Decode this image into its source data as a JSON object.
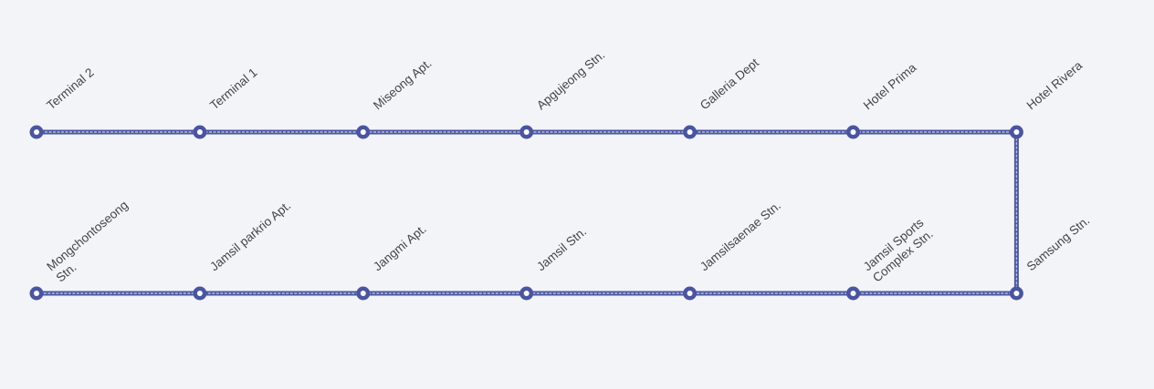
{
  "route": {
    "line_color": "#4a55a2",
    "line_inner_color": "#b7bde0",
    "marker_fill": "#ffffff",
    "rows": [
      {
        "stops": [
          {
            "lines": [
              "Terminal 2"
            ]
          },
          {
            "lines": [
              "Terminal 1"
            ]
          },
          {
            "lines": [
              "Miseong Apt."
            ]
          },
          {
            "lines": [
              "Apgujeong Stn."
            ]
          },
          {
            "lines": [
              "Galleria Dept"
            ]
          },
          {
            "lines": [
              "Hotel Prima"
            ]
          },
          {
            "lines": [
              "Hotel Rivera"
            ]
          }
        ]
      },
      {
        "stops": [
          {
            "lines": [
              "Mongchontoseong",
              "Stn."
            ]
          },
          {
            "lines": [
              "Jamsil parkrio Apt."
            ]
          },
          {
            "lines": [
              "Jangmi Apt."
            ]
          },
          {
            "lines": [
              "Jamsil Stn."
            ]
          },
          {
            "lines": [
              "Jamsilsaenae Stn."
            ]
          },
          {
            "lines": [
              "Jamsil Sports",
              "Complex Stn."
            ]
          },
          {
            "lines": [
              "Samsung Stn."
            ]
          }
        ]
      }
    ]
  }
}
